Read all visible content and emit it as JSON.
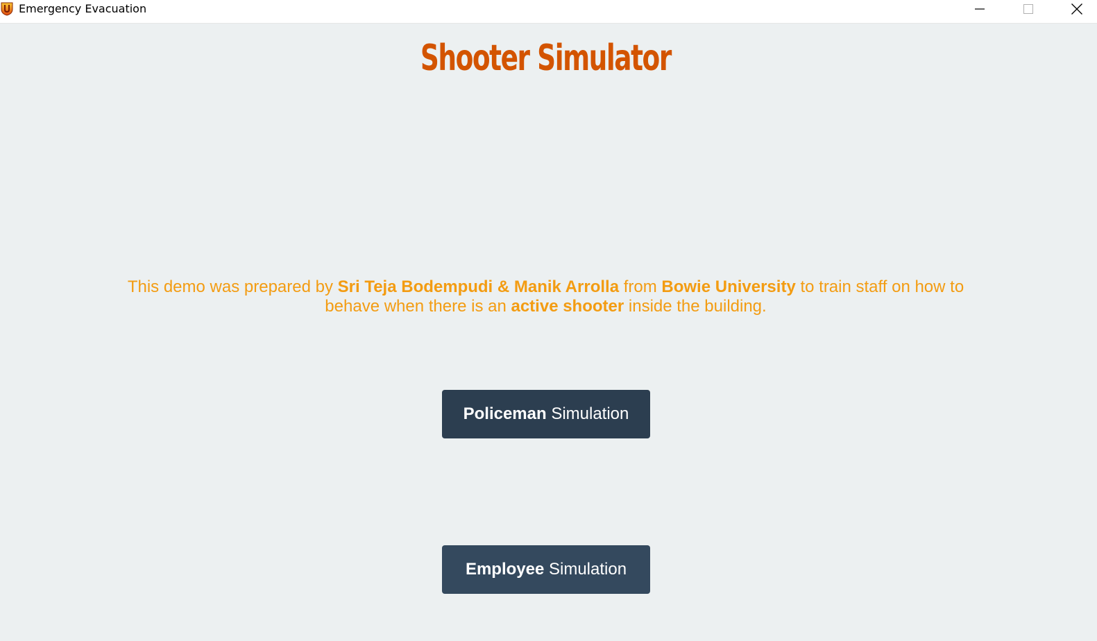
{
  "window": {
    "title": "Emergency Evacuation",
    "icon": "shield-app-icon",
    "controls": [
      "minimize-icon",
      "maximize-icon",
      "close-icon"
    ]
  },
  "app": {
    "title": "Shooter Simulator",
    "description": {
      "part1": "This demo was prepared by ",
      "authors": "Sri Teja Bodempudi & Manik Arrolla",
      "part2": " from ",
      "university": "Bowie University",
      "part3": " to train staff on how to behave when there is an ",
      "highlight": "active shooter",
      "part4": " inside the building."
    }
  },
  "buttons": {
    "policeman": {
      "bold": "Policeman",
      "rest": " Simulation"
    },
    "employee": {
      "bold": "Employee",
      "rest": " Simulation"
    }
  },
  "colors": {
    "title": "#d35400",
    "description": "#f39c12",
    "background": "#ecf0f1",
    "policeman_button": "#2c3e50",
    "employee_button": "#34495e"
  }
}
